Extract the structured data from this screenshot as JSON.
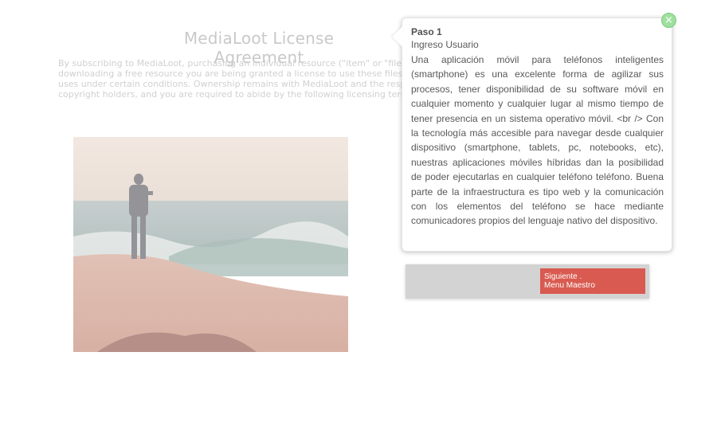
{
  "page": {
    "title": "MediaLoot License Agreement",
    "license_lines": [
      "By subscribing to MediaLoot, purchasing an individual resource (\"item\" or \"file\") or",
      "downloading a free resource you are being granted a license to use these files for specific",
      "uses under certain conditions. Ownership remains with MediaLoot and the respective",
      "copyright holders, and you are required to abide by the following licensing terms."
    ]
  },
  "tour": {
    "step": "Paso 1",
    "subtitle": "Ingreso Usuario",
    "description": "Una aplicación móvil para teléfonos inteligentes (smartphone) es una excelente forma de agilizar sus procesos, tener disponibilidad de su software móvil en cualquier momento y cualquier lugar al mismo tiempo de tener presencia en un sistema operativo móvil. <br /> Con la tecnología más accesible para navegar desde cualquier dispositivo (smartphone, tablets, pc, notebooks, etc), nuestras aplicaciones móviles híbridas dan la posibilidad de poder ejecutarlas en cualquier teléfono teléfono. Buena parte de la infraestructura es tipo web y la comunicación con los elementos del teléfono se hace mediante comunicadores propios del lenguaje nativo del dispositivo.",
    "close_symbol": "×",
    "next_line1": "Siguiente .",
    "next_line2": "Menu Maestro"
  },
  "colors": {
    "close": "#9fe09f",
    "next_button": "#d95a50",
    "footer": "#d3d3d3"
  },
  "icons": {
    "close": "close-icon",
    "pointer": "callout-pointer"
  }
}
